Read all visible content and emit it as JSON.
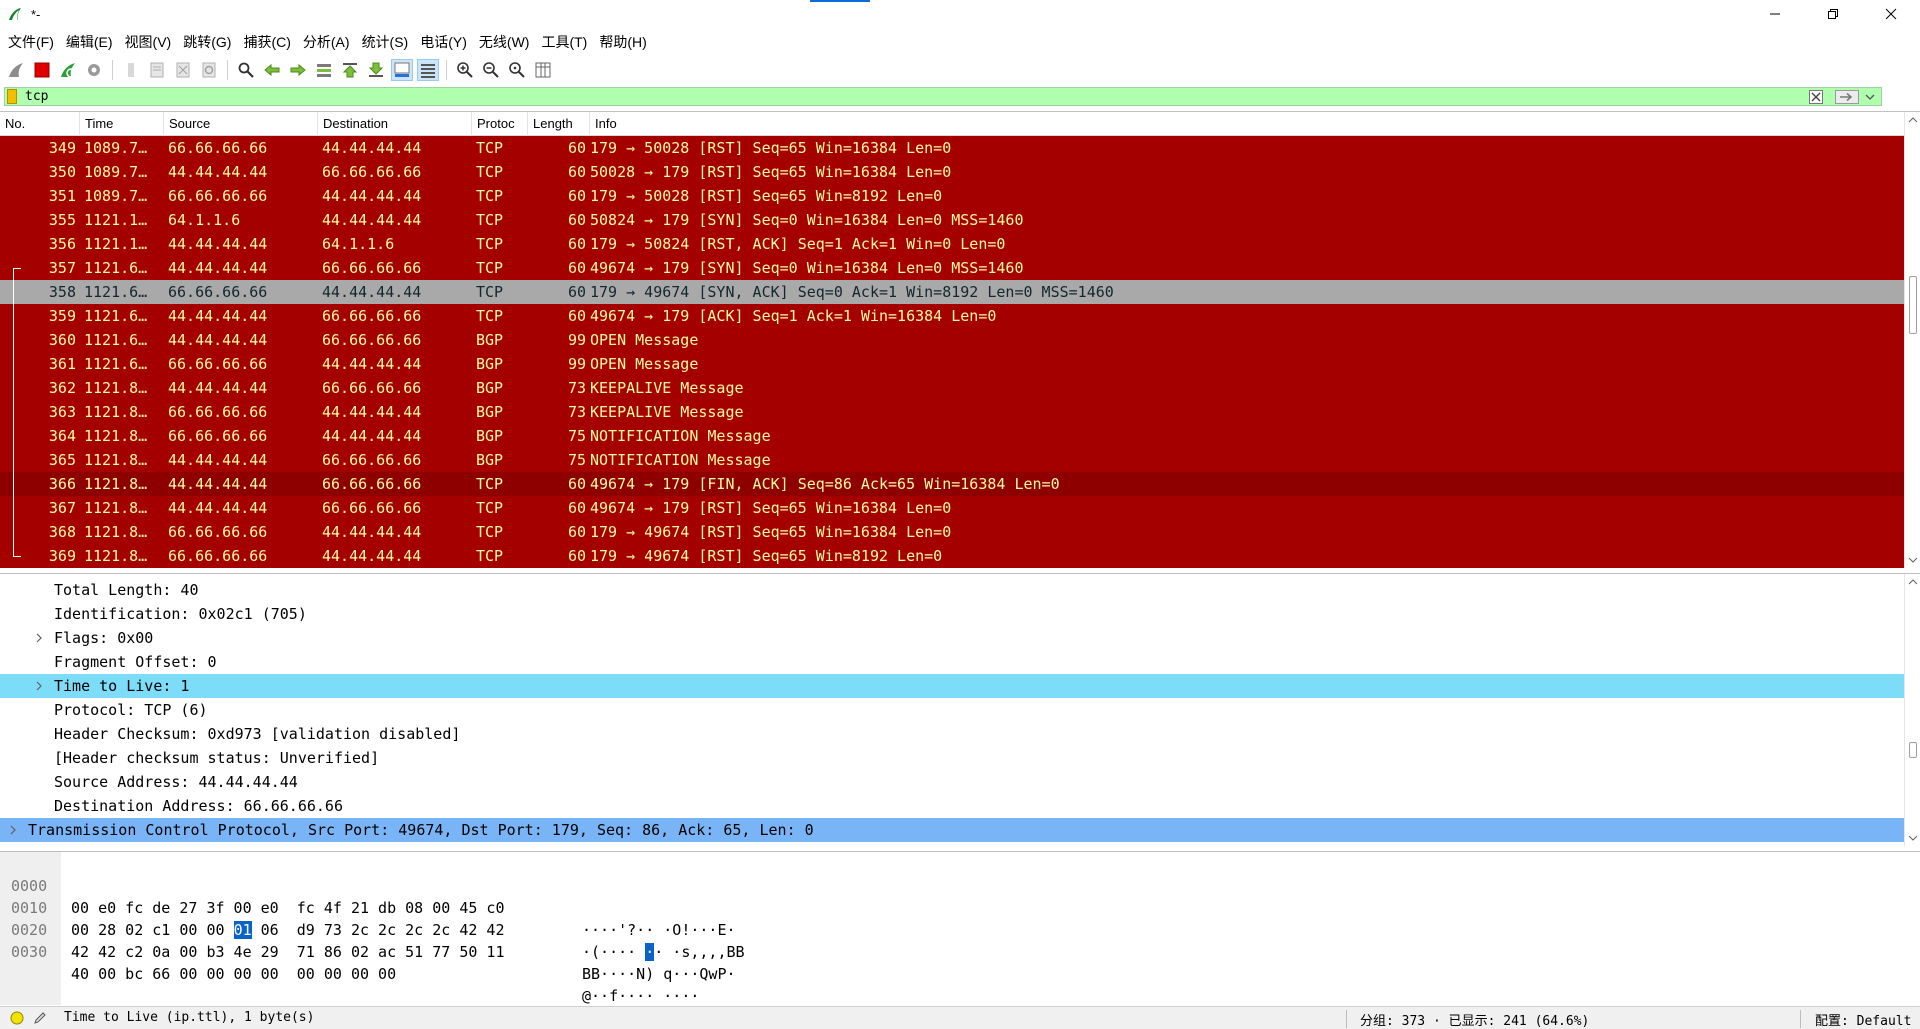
{
  "window": {
    "title": "*-"
  },
  "menu": [
    "文件(F)",
    "编辑(E)",
    "视图(V)",
    "跳转(G)",
    "捕获(C)",
    "分析(A)",
    "统计(S)",
    "电话(Y)",
    "无线(W)",
    "工具(T)",
    "帮助(H)"
  ],
  "filter": {
    "value": "tcp",
    "add_label": "+"
  },
  "colors": {
    "row_bg": "#a40000",
    "row_fg": "#fffc9c",
    "selected_bg": "#a9a9a9",
    "filter_bg": "#afffaf",
    "detail_hl": "#7ddcf8",
    "detail_hl2": "#79b4f6"
  },
  "packet_list": {
    "columns": [
      "No.",
      "Time",
      "Source",
      "Destination",
      "Protoc",
      "Length",
      "Info"
    ],
    "rows": [
      {
        "no": "349",
        "time": "1089.7…",
        "src": "66.66.66.66",
        "dst": "44.44.44.44",
        "proto": "TCP",
        "len": "60",
        "info": "179 → 50028 [RST] Seq=65 Win=16384 Len=0"
      },
      {
        "no": "350",
        "time": "1089.7…",
        "src": "44.44.44.44",
        "dst": "66.66.66.66",
        "proto": "TCP",
        "len": "60",
        "info": "50028 → 179 [RST] Seq=65 Win=16384 Len=0"
      },
      {
        "no": "351",
        "time": "1089.7…",
        "src": "66.66.66.66",
        "dst": "44.44.44.44",
        "proto": "TCP",
        "len": "60",
        "info": "179 → 50028 [RST] Seq=65 Win=8192 Len=0"
      },
      {
        "no": "355",
        "time": "1121.1…",
        "src": "64.1.1.6",
        "dst": "44.44.44.44",
        "proto": "TCP",
        "len": "60",
        "info": "50824 → 179 [SYN] Seq=0 Win=16384 Len=0 MSS=1460"
      },
      {
        "no": "356",
        "time": "1121.1…",
        "src": "44.44.44.44",
        "dst": "64.1.1.6",
        "proto": "TCP",
        "len": "60",
        "info": "179 → 50824 [RST, ACK] Seq=1 Ack=1 Win=0 Len=0"
      },
      {
        "no": "357",
        "time": "1121.6…",
        "src": "44.44.44.44",
        "dst": "66.66.66.66",
        "proto": "TCP",
        "len": "60",
        "info": "49674 → 179 [SYN] Seq=0 Win=16384 Len=0 MSS=1460"
      },
      {
        "no": "358",
        "time": "1121.6…",
        "src": "66.66.66.66",
        "dst": "44.44.44.44",
        "proto": "TCP",
        "len": "60",
        "info": "179 → 49674 [SYN, ACK] Seq=0 Ack=1 Win=8192 Len=0 MSS=1460",
        "selected": true
      },
      {
        "no": "359",
        "time": "1121.6…",
        "src": "44.44.44.44",
        "dst": "66.66.66.66",
        "proto": "TCP",
        "len": "60",
        "info": "49674 → 179 [ACK] Seq=1 Ack=1 Win=16384 Len=0"
      },
      {
        "no": "360",
        "time": "1121.6…",
        "src": "44.44.44.44",
        "dst": "66.66.66.66",
        "proto": "BGP",
        "len": "99",
        "info": "OPEN Message"
      },
      {
        "no": "361",
        "time": "1121.6…",
        "src": "66.66.66.66",
        "dst": "44.44.44.44",
        "proto": "BGP",
        "len": "99",
        "info": "OPEN Message"
      },
      {
        "no": "362",
        "time": "1121.8…",
        "src": "44.44.44.44",
        "dst": "66.66.66.66",
        "proto": "BGP",
        "len": "73",
        "info": "KEEPALIVE Message"
      },
      {
        "no": "363",
        "time": "1121.8…",
        "src": "66.66.66.66",
        "dst": "44.44.44.44",
        "proto": "BGP",
        "len": "73",
        "info": "KEEPALIVE Message"
      },
      {
        "no": "364",
        "time": "1121.8…",
        "src": "66.66.66.66",
        "dst": "44.44.44.44",
        "proto": "BGP",
        "len": "75",
        "info": "NOTIFICATION Message"
      },
      {
        "no": "365",
        "time": "1121.8…",
        "src": "44.44.44.44",
        "dst": "66.66.66.66",
        "proto": "BGP",
        "len": "75",
        "info": "NOTIFICATION Message"
      },
      {
        "no": "366",
        "time": "1121.8…",
        "src": "44.44.44.44",
        "dst": "66.66.66.66",
        "proto": "TCP",
        "len": "60",
        "info": "49674 → 179 [FIN, ACK] Seq=86 Ack=65 Win=16384 Len=0",
        "fin": true
      },
      {
        "no": "367",
        "time": "1121.8…",
        "src": "44.44.44.44",
        "dst": "66.66.66.66",
        "proto": "TCP",
        "len": "60",
        "info": "49674 → 179 [RST] Seq=65 Win=16384 Len=0"
      },
      {
        "no": "368",
        "time": "1121.8…",
        "src": "66.66.66.66",
        "dst": "44.44.44.44",
        "proto": "TCP",
        "len": "60",
        "info": "179 → 49674 [RST] Seq=65 Win=16384 Len=0"
      },
      {
        "no": "369",
        "time": "1121.8…",
        "src": "66.66.66.66",
        "dst": "44.44.44.44",
        "proto": "TCP",
        "len": "60",
        "info": "179 → 49674 [RST] Seq=65 Win=8192 Len=0"
      }
    ]
  },
  "details": [
    {
      "text": "Total Length: 40",
      "level": 2
    },
    {
      "text": "Identification: 0x02c1 (705)",
      "level": 2
    },
    {
      "text": "Flags: 0x00",
      "level": 2,
      "expander": true
    },
    {
      "text": "Fragment Offset: 0",
      "level": 2
    },
    {
      "text": "Time to Live: 1",
      "level": 2,
      "expander": true,
      "highlight": "hl"
    },
    {
      "text": "Protocol: TCP (6)",
      "level": 2
    },
    {
      "text": "Header Checksum: 0xd973 [validation disabled]",
      "level": 2
    },
    {
      "text": "[Header checksum status: Unverified]",
      "level": 2
    },
    {
      "text": "Source Address: 44.44.44.44",
      "level": 2
    },
    {
      "text": "Destination Address: 66.66.66.66",
      "level": 2
    },
    {
      "text": "Transmission Control Protocol, Src Port: 49674, Dst Port: 179, Seq: 86, Ack: 65, Len: 0",
      "level": 1,
      "expander": true,
      "highlight": "hl2"
    }
  ],
  "bytes": [
    {
      "offset": "0000",
      "hex_a": "00 e0 fc de 27 3f 00 e0  fc 4f 21 db 08 00 45 c0",
      "ascii": "····'?·· ·O!···E·"
    },
    {
      "offset": "0010",
      "hex_pre": "00 28 02 c1 00 00 ",
      "hex_sel": "01",
      "hex_post": " 06  d9 73 2c 2c 2c 2c 42 42",
      "ascii_pre": "·(···· ",
      "ascii_sel": "·",
      "ascii_post": "· ·s,,,,BB"
    },
    {
      "offset": "0020",
      "hex_a": "42 42 c2 0a 00 b3 4e 29  71 86 02 ac 51 77 50 11",
      "ascii": "BB····N) q···QwP·"
    },
    {
      "offset": "0030",
      "hex_a": "40 00 bc 66 00 00 00 00  00 00 00 00",
      "ascii": "@··f···· ····"
    }
  ],
  "status": {
    "field_text": "Time to Live (ip.ttl), 1 byte(s)",
    "packets_text": "分组: 373 · 已显示: 241 (64.6%)",
    "profile_text": "配置: Default"
  }
}
